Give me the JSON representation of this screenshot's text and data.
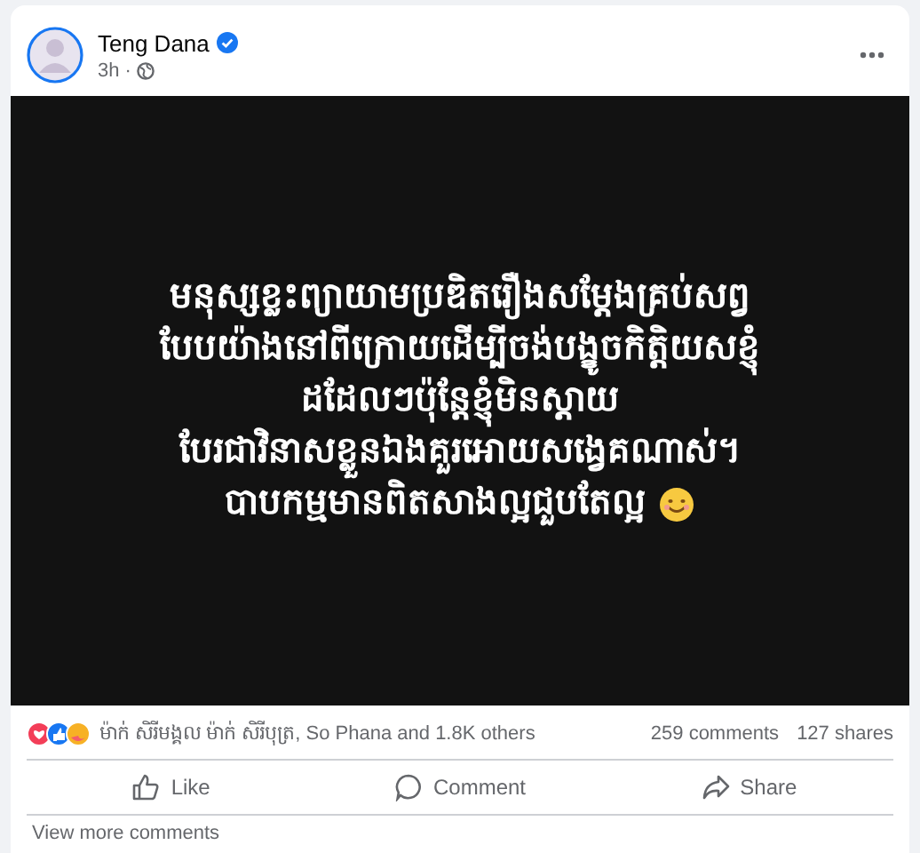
{
  "post": {
    "author": "Teng Dana",
    "verified": true,
    "time": "3h",
    "separator": "·",
    "text_lines": [
      "មនុស្សខ្លះព្យាយាមប្រឌិតរឿងសម្តែងគ្រប់សព្វ",
      "បែបយ៉ាងនៅពីក្រោយដើម្បីចង់បង្ខូចកិត្តិយសខ្ញុំ",
      "ដដែលៗប៉ុន្តែខ្ញុំមិនស្តាយ",
      "បែរជាវិនាសខ្លួនឯងគួរអោយសង្វេគណាស់។",
      "បាបកម្មមានពិតសាងល្អជួបតែល្អ"
    ],
    "reactions_summary": "ម៉ាក់ សិរីមង្គល ម៉ាក់ សិរីបុត្រ, So Phana and 1.8K others",
    "comments": "259 comments",
    "shares": "127 shares",
    "actions": [
      "Like",
      "Comment",
      "Share"
    ],
    "view_more": "View more comments"
  }
}
